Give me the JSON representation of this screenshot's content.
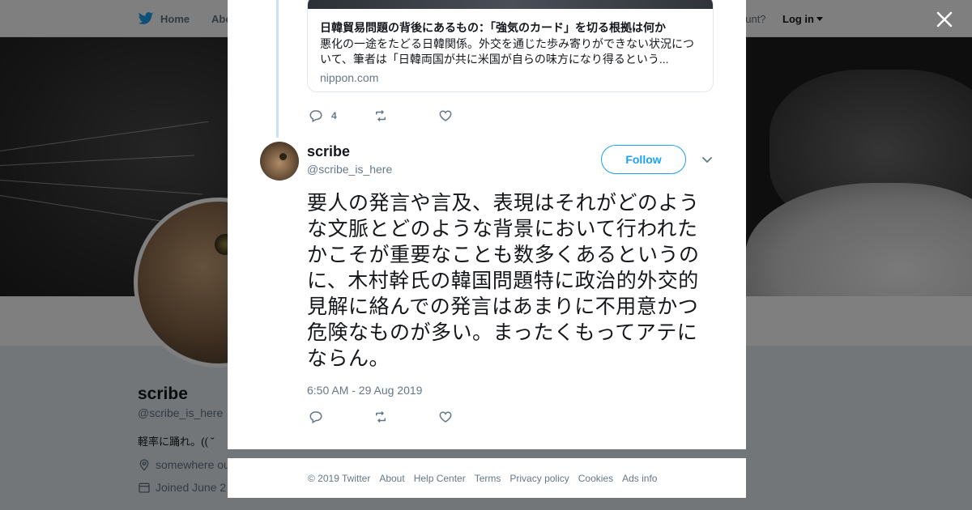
{
  "topbar": {
    "home_label": "Home",
    "about_label": "Abo",
    "account_prompt": "ccount?",
    "login_label": "Log in"
  },
  "profile": {
    "name": "scribe",
    "handle": "@scribe_is_here",
    "bio": "軽率に踊れ。((  ˘",
    "location": "somewhere ou",
    "joined": "Joined June 2"
  },
  "link_card": {
    "title": "日韓貿易問題の背後にあるもの：「強気のカード」を切る根拠は何か",
    "description": "悪化の一途をたどる日韓関係。外交を通じた歩み寄りができない状況について、筆者は「日韓両国が共に米国が自らの味方になり得るという...",
    "domain": "nippon.com"
  },
  "parent_actions": {
    "reply_count": "4"
  },
  "tweet": {
    "author_name": "scribe",
    "author_handle": "@scribe_is_here",
    "follow_label": "Follow",
    "text": "要人の発言や言及、表現はそれがどのような文脈とどのような背景において行われたかこそが重要なことも数多くあるというのに、木村幹氏の韓国問題特に政治的外交的見解に絡んでの発言はあまりに不用意かつ危険なものが多い。まったくもってアテにならん。",
    "timestamp": "6:50 AM - 29 Aug 2019"
  },
  "footer": {
    "copyright": "© 2019 Twitter",
    "links": [
      "About",
      "Help Center",
      "Terms",
      "Privacy policy",
      "Cookies",
      "Ads info"
    ]
  },
  "colors": {
    "accent": "#1da1f2",
    "thread_line": "#c4e4fb",
    "muted_text": "#657786",
    "overlay": "rgba(0,0,0,0.5)"
  },
  "icons": [
    "twitter-bird-icon",
    "close-icon",
    "reply-icon",
    "retweet-icon",
    "like-icon",
    "chevron-down-icon",
    "location-icon",
    "calendar-icon"
  ]
}
